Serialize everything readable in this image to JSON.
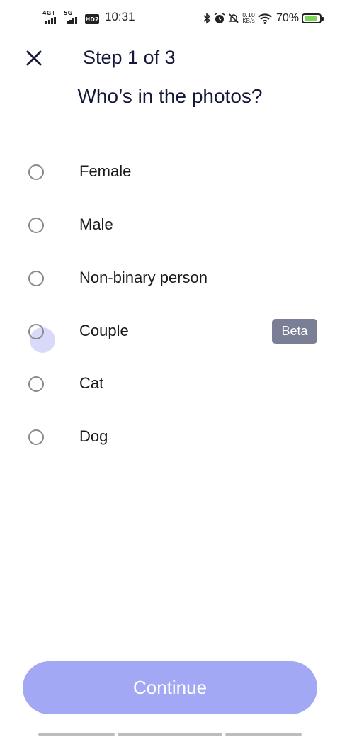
{
  "status_bar": {
    "network1": "4G+",
    "network2": "5G",
    "hd_badge": "HD2",
    "time": "10:31",
    "speed_value": "0.10",
    "speed_unit": "KB/s",
    "battery": "70%",
    "battery_color": "#7bd35a"
  },
  "header": {
    "close_icon": "close-icon",
    "step_label": "Step 1 of 3"
  },
  "question": "Who’s in the photos?",
  "options": [
    {
      "label": "Female",
      "selected": false
    },
    {
      "label": "Male",
      "selected": false
    },
    {
      "label": "Non-binary person",
      "selected": false
    },
    {
      "label": "Couple",
      "selected": false,
      "badge": "Beta"
    },
    {
      "label": "Cat",
      "selected": false
    },
    {
      "label": "Dog",
      "selected": false
    }
  ],
  "continue_label": "Continue",
  "colors": {
    "accent": "#a2a8f4",
    "title": "#15183a",
    "badge_bg": "#7b7f96"
  }
}
